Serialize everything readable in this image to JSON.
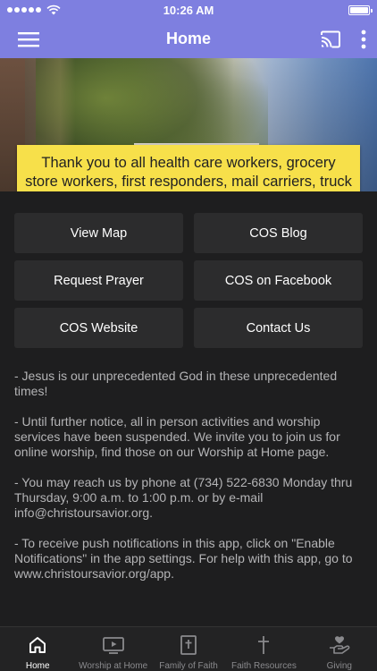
{
  "status_bar": {
    "time": "10:26 AM",
    "signal_icon": "signal-dots-icon",
    "wifi_icon": "wifi-icon",
    "battery_icon": "battery-icon"
  },
  "app_bar": {
    "title": "Home",
    "menu_icon": "hamburger-menu-icon",
    "cast_icon": "cast-icon",
    "more_icon": "more-vertical-icon",
    "color": "#7e7fe0"
  },
  "hero": {
    "notice_text": "Thank you to all health care workers, grocery store workers, first responders, mail carriers, truck & delivery drivers.",
    "notice_color": "#f7e04a"
  },
  "buttons": [
    {
      "label": "View Map"
    },
    {
      "label": "COS Blog"
    },
    {
      "label": "Request Prayer"
    },
    {
      "label": "COS on Facebook"
    },
    {
      "label": "COS Website"
    },
    {
      "label": "Contact Us"
    }
  ],
  "info": [
    "- Jesus is our unprecedented God in these unprecedented times!",
    "- Until further notice, all in person activities and worship services have been suspended. We invite you to join us for online worship, find those on our Worship at Home page.",
    "- You may reach us by phone at (734) 522-6830 Monday thru Thursday, 9:00 a.m. to 1:00 p.m. or by e-mail info@christoursavior.org.",
    "- To receive push notifications in this app, click on \"Enable Notifications\" in the app settings. For help with this app, go to www.christoursavior.org/app."
  ],
  "tabs": [
    {
      "label": "Home",
      "icon": "home-icon",
      "active": true
    },
    {
      "label": "Worship at Home",
      "icon": "tv-play-icon",
      "active": false
    },
    {
      "label": "Family of Faith",
      "icon": "bible-cross-icon",
      "active": false
    },
    {
      "label": "Faith Resources",
      "icon": "cross-icon",
      "active": false
    },
    {
      "label": "Giving",
      "icon": "giving-hand-icon",
      "active": false
    }
  ]
}
